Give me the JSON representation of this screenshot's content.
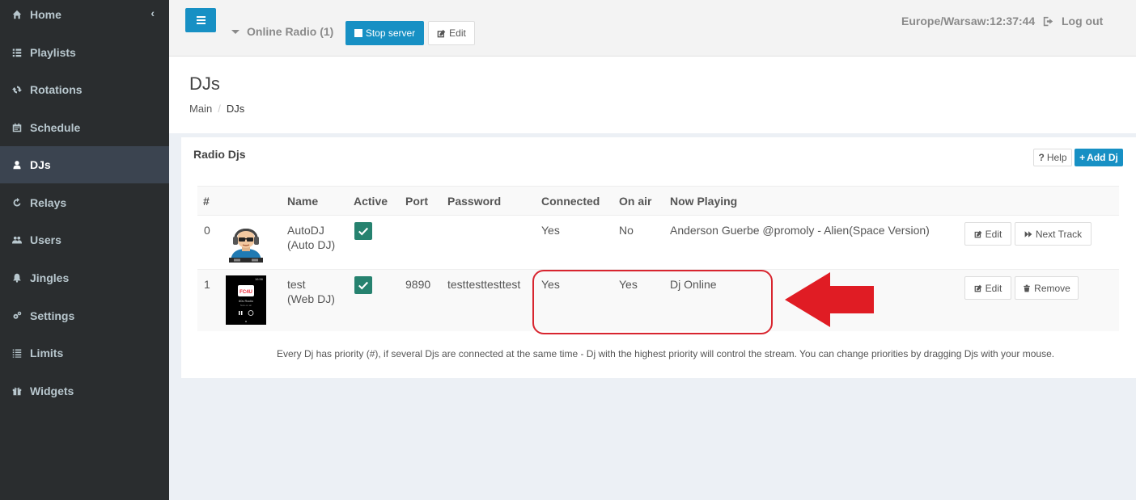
{
  "sidebar": {
    "items": [
      {
        "label": "Home",
        "icon": "home-icon"
      },
      {
        "label": "Playlists",
        "icon": "list-icon"
      },
      {
        "label": "Rotations",
        "icon": "refresh-icon"
      },
      {
        "label": "Schedule",
        "icon": "calendar-icon"
      },
      {
        "label": "DJs",
        "icon": "user-icon"
      },
      {
        "label": "Relays",
        "icon": "relay-icon"
      },
      {
        "label": "Users",
        "icon": "users-icon"
      },
      {
        "label": "Jingles",
        "icon": "bell-icon"
      },
      {
        "label": "Settings",
        "icon": "gears-icon"
      },
      {
        "label": "Limits",
        "icon": "list-icon"
      },
      {
        "label": "Widgets",
        "icon": "gift-icon"
      }
    ],
    "active": "DJs",
    "collapse_glyph": "‹"
  },
  "topbar": {
    "radio_label": "Online Radio (1)",
    "stop_label": "Stop server",
    "edit_label": "Edit",
    "timezone": "Europe/Warsaw:12:37:44",
    "logout_label": "Log out"
  },
  "page": {
    "title": "DJs",
    "breadcrumb": [
      "Main",
      "DJs"
    ],
    "breadcrumb_sep": "/"
  },
  "box": {
    "title": "Radio Djs",
    "help_label": "Help",
    "help_glyph": "?",
    "add_label": "Add Dj",
    "add_glyph": "+"
  },
  "table": {
    "headers": [
      "#",
      "Name",
      "Active",
      "Port",
      "Password",
      "Connected",
      "On air",
      "Now Playing"
    ],
    "rows": [
      {
        "num": "0",
        "name": "AutoDJ",
        "type": "(Auto DJ)",
        "active": true,
        "port": "",
        "password": "",
        "connected": "Yes",
        "on_air": "No",
        "now_playing": "Anderson Guerbe @promoly - Alien(Space Version)",
        "actions": [
          "Edit",
          "Next Track"
        ]
      },
      {
        "num": "1",
        "name": "test",
        "type": "(Web DJ)",
        "active": true,
        "port": "9890",
        "password": "testtesttesttest",
        "connected": "Yes",
        "on_air": "Yes",
        "now_playing": "Dj Online",
        "actions": [
          "Edit",
          "Remove"
        ]
      }
    ]
  },
  "phone_thumb": {
    "time": "16:56",
    "logo": "FC4U",
    "line1": "80s Radio",
    "line2": "Now on air"
  },
  "note": "Every Dj has priority (#), if several Djs are connected at the same time - Dj with the highest priority will control the stream. You can change priorities by dragging Djs with your mouse.",
  "colors": {
    "sidebar_bg": "#2a2d2f",
    "accent": "#1790c4",
    "check_green": "#26826f",
    "annotation_red": "#d8252f"
  }
}
